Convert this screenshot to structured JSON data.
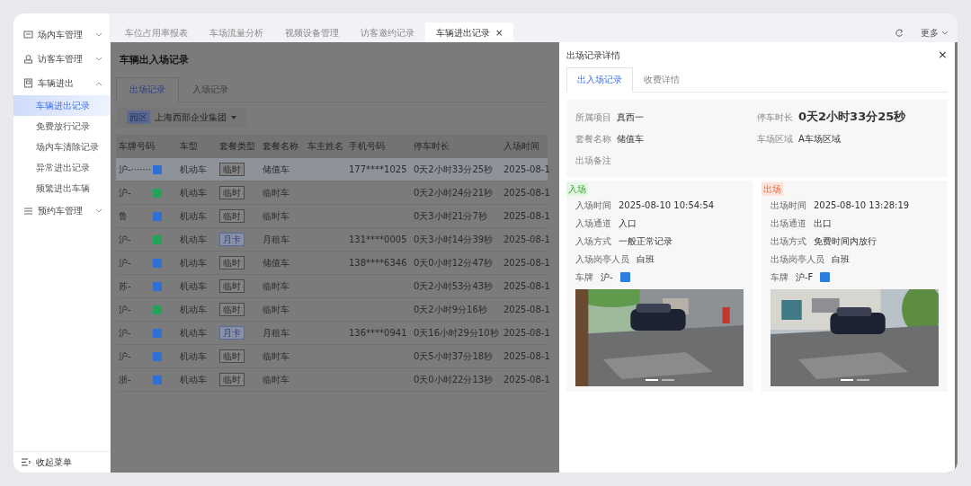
{
  "sidebar": {
    "items": [
      {
        "label": "场内车管理",
        "expanded": false
      },
      {
        "label": "访客车管理",
        "expanded": false
      },
      {
        "label": "车辆进出",
        "expanded": true,
        "children": [
          {
            "label": "车辆进出记录",
            "selected": true
          },
          {
            "label": "免费放行记录",
            "selected": false
          },
          {
            "label": "场内车清除记录",
            "selected": false
          },
          {
            "label": "异常进出记录",
            "selected": false
          },
          {
            "label": "频繁进出车辆",
            "selected": false
          }
        ]
      },
      {
        "label": "预约车管理",
        "expanded": false
      }
    ],
    "collapse_label": "收起菜单"
  },
  "page_tabs": [
    {
      "label": "车位占用率报表",
      "selected": false
    },
    {
      "label": "车场流量分析",
      "selected": false
    },
    {
      "label": "视频设备管理",
      "selected": false
    },
    {
      "label": "访客邀约记录",
      "selected": false
    },
    {
      "label": "车辆进出记录",
      "selected": true,
      "close": "×"
    }
  ],
  "toolbar": {
    "more": "更多"
  },
  "page": {
    "title": "车辆出入场记录",
    "tabs": [
      {
        "label": "出场记录",
        "selected": true
      },
      {
        "label": "入场记录",
        "selected": false
      }
    ],
    "filter": {
      "tag": "园区",
      "value": "上海西部企业集团"
    }
  },
  "table": {
    "columns": [
      "车牌号码",
      "车型",
      "套餐类型",
      "套餐名称",
      "车主姓名",
      "手机号码",
      "停车时长",
      "入场时间"
    ],
    "rows": [
      {
        "plate": "沪-·······",
        "color": "#2f6fd6",
        "vehicle": "机动车",
        "package_type": "临时",
        "kind": "temp",
        "package_name": "储值车",
        "phone": "177****1025",
        "duration": "0天2小时33分25秒",
        "entry_time": "2025-08-1",
        "selected": true
      },
      {
        "plate": "沪-",
        "color": "#22a35a",
        "vehicle": "机动车",
        "package_type": "临时",
        "kind": "temp",
        "package_name": "临时车",
        "duration": "0天2小时24分21秒",
        "entry_time": "2025-08-1",
        "selected": false
      },
      {
        "plate": "鲁",
        "color": "#2f6fd6",
        "vehicle": "机动车",
        "package_type": "临时",
        "kind": "temp",
        "package_name": "临时车",
        "duration": "0天3小时21分7秒",
        "entry_time": "2025-08-1",
        "selected": false
      },
      {
        "plate": "沪-",
        "color": "#22a35a",
        "vehicle": "机动车",
        "package_type": "月卡",
        "kind": "monthly",
        "package_name": "月租车",
        "phone": "131****0005",
        "duration": "0天3小时14分39秒",
        "entry_time": "2025-08-1",
        "selected": false
      },
      {
        "plate": "沪-",
        "color": "#2f6fd6",
        "vehicle": "机动车",
        "package_type": "临时",
        "kind": "temp",
        "package_name": "储值车",
        "phone": "138****6346",
        "duration": "0天0小时12分47秒",
        "entry_time": "2025-08-1",
        "selected": false
      },
      {
        "plate": "苏-",
        "color": "#2f6fd6",
        "vehicle": "机动车",
        "package_type": "临时",
        "kind": "temp",
        "package_name": "临时车",
        "duration": "0天2小时53分43秒",
        "entry_time": "2025-08-1",
        "selected": false
      },
      {
        "plate": "沪-",
        "color": "#22a35a",
        "vehicle": "机动车",
        "package_type": "临时",
        "kind": "temp",
        "package_name": "临时车",
        "duration": "0天2小时9分16秒",
        "entry_time": "2025-08-1",
        "selected": false
      },
      {
        "plate": "沪-",
        "color": "#2f6fd6",
        "vehicle": "机动车",
        "package_type": "月卡",
        "kind": "monthly",
        "package_name": "月租车",
        "phone": "136****0941",
        "duration": "0天16小时29分10秒",
        "entry_time": "2025-08-1",
        "selected": false
      },
      {
        "plate": "沪-",
        "color": "#2f6fd6",
        "vehicle": "机动车",
        "package_type": "临时",
        "kind": "temp",
        "package_name": "临时车",
        "duration": "0天5小时37分18秒",
        "entry_time": "2025-08-1",
        "selected": false
      },
      {
        "plate": "浙-",
        "color": "#2f6fd6",
        "vehicle": "机动车",
        "package_type": "临时",
        "kind": "temp",
        "package_name": "临时车",
        "duration": "0天0小时22分13秒",
        "entry_time": "2025-08-1",
        "selected": false
      }
    ]
  },
  "drawer": {
    "title": "出场记录详情",
    "close": "×",
    "tabs": [
      {
        "label": "出入场记录",
        "selected": true
      },
      {
        "label": "收费详情",
        "selected": false
      }
    ],
    "info": [
      {
        "label": "所属项目",
        "value": "真西一",
        "emphasis": false
      },
      {
        "label": "停车时长",
        "value": "0天2小时33分25秒",
        "emphasis": true
      },
      {
        "label": "套餐名称",
        "value": "储值车",
        "emphasis": false
      },
      {
        "label": "车场区域",
        "value": "A车场区域",
        "emphasis": false
      },
      {
        "label": "出场备注"
      }
    ],
    "records": [
      {
        "tag": "入场",
        "kind": "entry",
        "fields": [
          {
            "label": "入场时间",
            "value": "2025-08-10 10:54:54"
          },
          {
            "label": "入场通道",
            "value": "入口"
          },
          {
            "label": "入场方式",
            "value": "一般正常记录"
          },
          {
            "label": "入场岗亭人员",
            "value": "白班"
          }
        ],
        "plate_label": "车牌",
        "plate": "沪-",
        "color": "#2f7de0",
        "picture": {
          "kind": "picture"
        }
      },
      {
        "tag": "出场",
        "kind": "exit",
        "fields": [
          {
            "label": "出场时间",
            "value": "2025-08-10 13:28:19"
          },
          {
            "label": "出场通道",
            "value": "出口"
          },
          {
            "label": "出场方式",
            "value": "免费时间内放行"
          },
          {
            "label": "出场岗亭人员",
            "value": "白班"
          }
        ],
        "plate_label": "车牌",
        "plate": "沪-F",
        "color": "#2f7de0",
        "picture": {
          "kind": "picture"
        }
      }
    ]
  }
}
